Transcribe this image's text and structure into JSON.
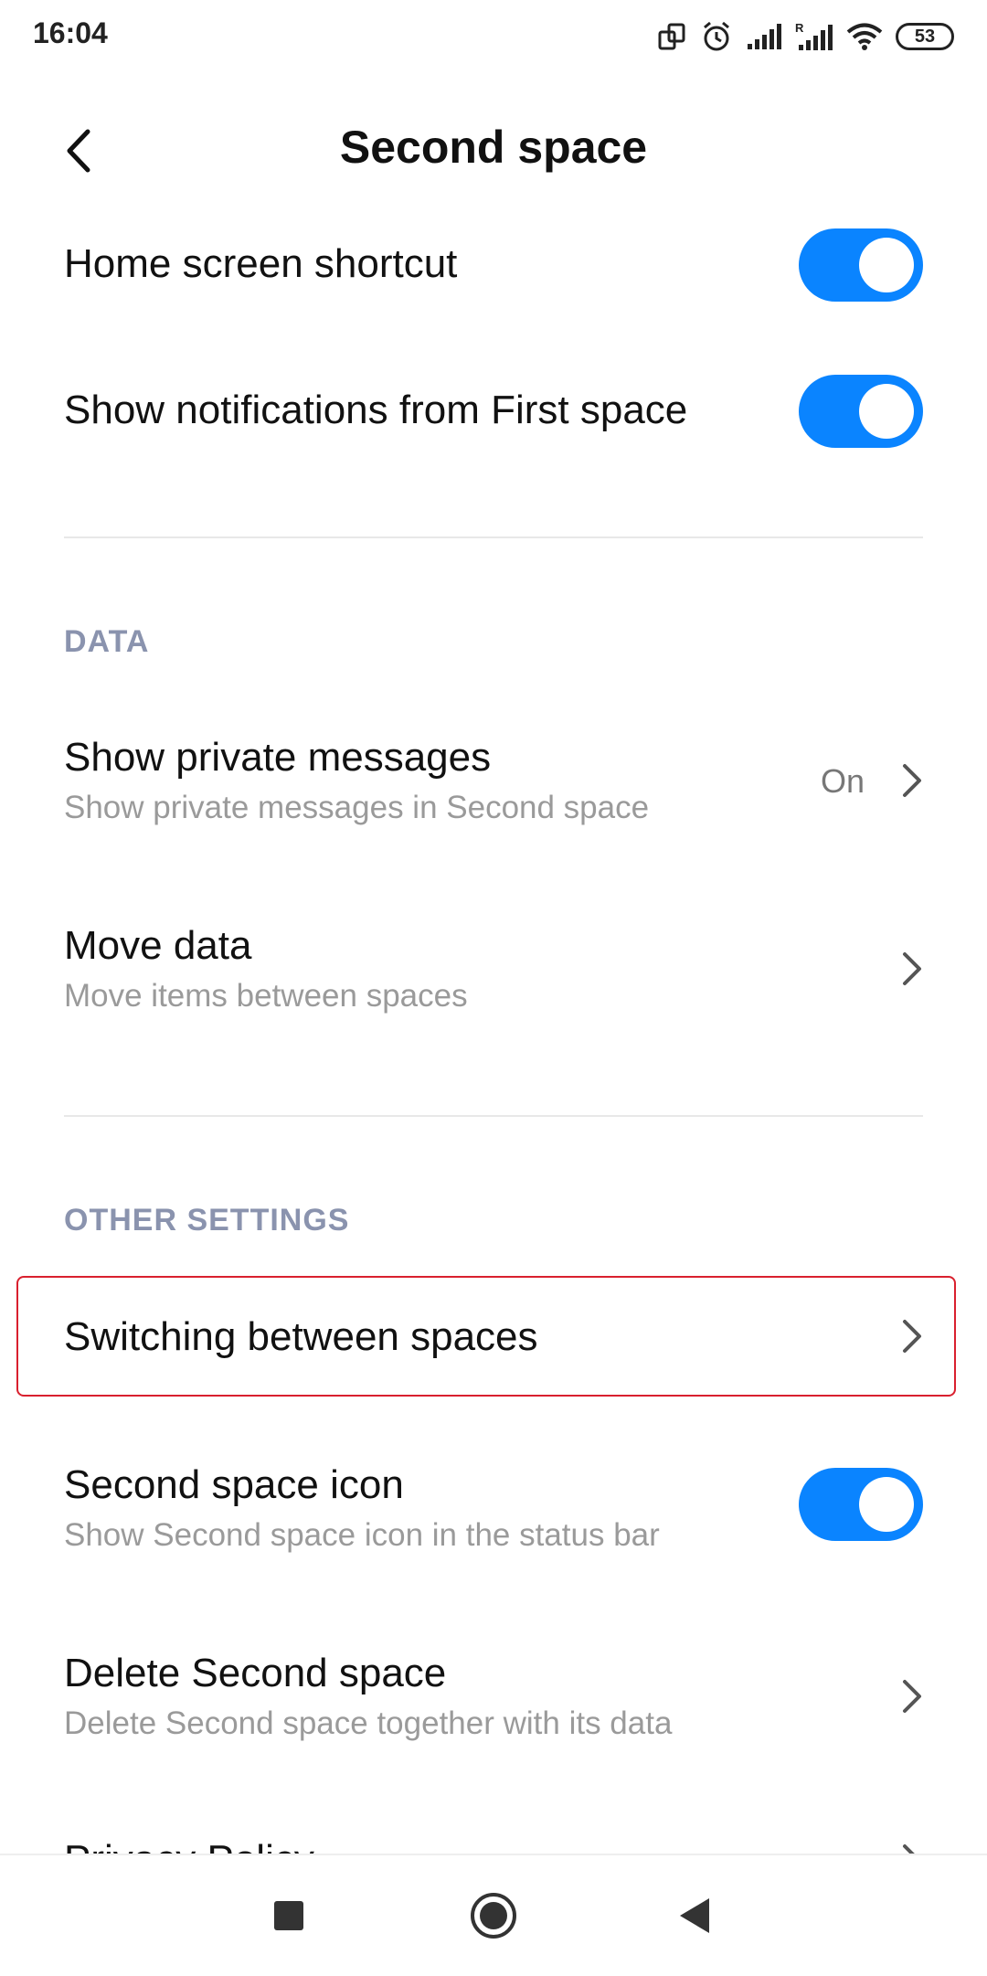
{
  "status_bar": {
    "time": "16:04",
    "battery": "53",
    "icons": [
      "dual-screen-icon",
      "alarm-icon",
      "signal-icon",
      "roaming-signal-icon",
      "wifi-icon",
      "battery-icon"
    ]
  },
  "header": {
    "title": "Second space",
    "back_icon": "back-arrow-icon"
  },
  "toggles_top": [
    {
      "label": "Home screen shortcut",
      "enabled": true
    },
    {
      "label": "Show notifications from First space",
      "enabled": true
    }
  ],
  "data_section": {
    "title": "DATA",
    "items": [
      {
        "label": "Show private messages",
        "subtitle": "Show private messages in Second space",
        "value": "On"
      },
      {
        "label": "Move data",
        "subtitle": "Move items between spaces"
      }
    ]
  },
  "other_section": {
    "title": "OTHER SETTINGS",
    "items": [
      {
        "label": "Switching between spaces"
      },
      {
        "label": "Second space icon",
        "subtitle": "Show Second space icon in the status bar",
        "enabled": true
      },
      {
        "label": "Delete Second space",
        "subtitle": "Delete Second space together with its data"
      },
      {
        "label": "Privacy Policy"
      }
    ]
  },
  "nav_bar": {
    "buttons": [
      "recents-square-icon",
      "home-circle-icon",
      "back-triangle-icon"
    ]
  },
  "colors": {
    "accent": "#0a84ff",
    "section_header": "#8a93ae",
    "highlight_border": "#d9202e"
  }
}
